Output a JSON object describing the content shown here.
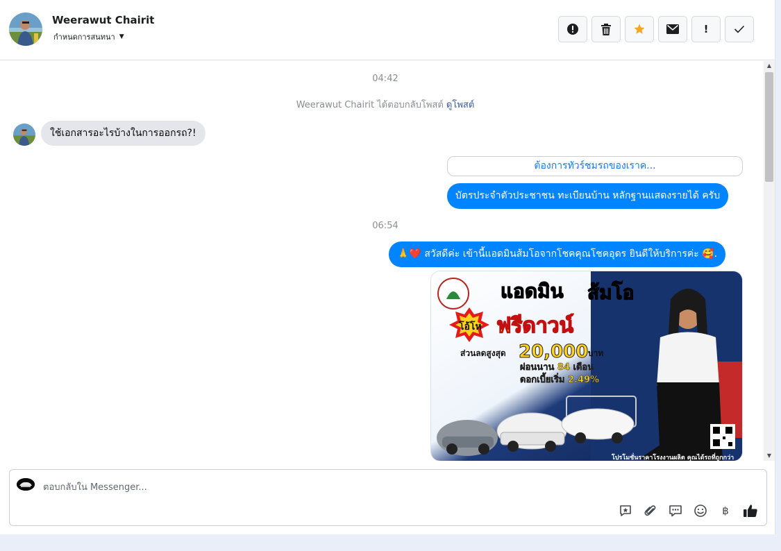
{
  "header": {
    "name": "Weerawut Chairit",
    "assign_label": "กำหนดการสนทนา",
    "actions": [
      {
        "icon": "alert-circle-icon",
        "label": "!"
      },
      {
        "icon": "trash-icon"
      },
      {
        "icon": "star-icon",
        "color": "#f5a623"
      },
      {
        "icon": "envelope-icon"
      },
      {
        "icon": "exclamation-icon",
        "label": "!"
      },
      {
        "icon": "check-icon",
        "label": "✓"
      }
    ]
  },
  "thread": {
    "timestamp_1": "04:42",
    "system_text": "Weerawut Chairit ได้ตอบกลับโพสต์",
    "system_link": "ดูโพสต์",
    "incoming_1": "ใช้เอกสารอะไรบ้างในการออกรถ?!",
    "quick_reply": "ต้องการทัวร์ชมรถของเราค...",
    "outgoing_1": "บัตรประจำตัวประชาชน ทะเบียนบ้าน หลักฐานแสดงรายได้ ครับ",
    "timestamp_2": "06:54",
    "outgoing_2": "🙏❤️ สวัสดีค่ะ เข้านี้แอดมินส้มโอจากโชคคุณโชคอุดร ยินดีให้บริการค่ะ 🥰.",
    "promo": {
      "headline_1": "แอดมิน",
      "headline_2": "ส้มโอ",
      "badge": "โอ้โห",
      "free_down": "ฟรีดาวน์",
      "discount_label": "ส่วนลดสูงสุด",
      "discount_amount": "20,000",
      "discount_unit": "บาท",
      "installment": "ผ่อนนาน 84 เดือน",
      "interest": "ดอกเบี้ยเริ่ม 2.49%",
      "footer": "โปรโมชั่นราคาโรงงานผลิต คุณได้รถที่ถูกกว่า"
    }
  },
  "composer": {
    "placeholder": "ตอบกลับใน Messenger...",
    "tools": [
      "saved-reply-icon",
      "paperclip-icon",
      "chat-bubbles-icon",
      "smiley-icon",
      "baht-icon",
      "thumbs-up-icon"
    ],
    "baht_symbol": "฿"
  },
  "colors": {
    "accent": "#0084ff",
    "link": "#385898",
    "incoming_bubble": "#e4e6eb"
  }
}
